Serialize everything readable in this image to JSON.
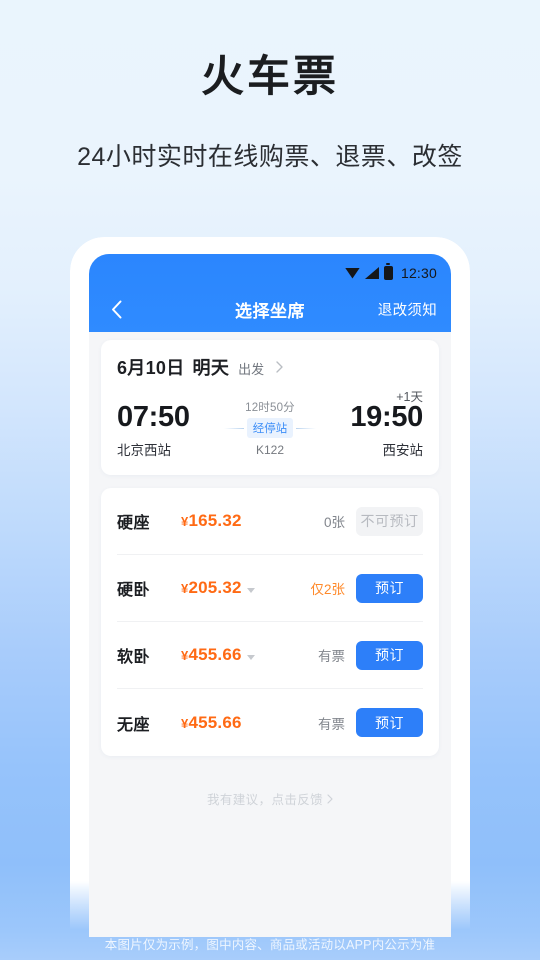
{
  "hero": {
    "title": "火车票",
    "subtitle": "24小时实时在线购票、退票、改签"
  },
  "phone": {
    "status_bar": {
      "time": "12:30",
      "icons": [
        "wifi-icon",
        "signal-icon",
        "battery-icon"
      ]
    },
    "navbar": {
      "back_icon": "chevron-left-icon",
      "title": "选择坐席",
      "right_link": "退改须知"
    },
    "trip_card": {
      "date": "6月10日",
      "day_label": "明天",
      "depart_label": "出发",
      "chevron_icon": "chevron-right-icon",
      "depart_time": "07:50",
      "depart_station": "北京西站",
      "arrive_time": "19:50",
      "arrive_station": "西安站",
      "plus_day": "+1天",
      "duration": "12时50分",
      "stop_badge": "经停站",
      "train_no": "K122"
    },
    "seat_table": {
      "rows": [
        {
          "name": "硬座",
          "currency": "¥",
          "price": "165.32",
          "has_caret": false,
          "stock": "0张",
          "stock_warn": false,
          "button": "不可预订",
          "enabled": false
        },
        {
          "name": "硬卧",
          "currency": "¥",
          "price": "205.32",
          "has_caret": true,
          "stock": "仅2张",
          "stock_warn": true,
          "button": "预订",
          "enabled": true
        },
        {
          "name": "软卧",
          "currency": "¥",
          "price": "455.66",
          "has_caret": true,
          "stock": "有票",
          "stock_warn": false,
          "button": "预订",
          "enabled": true
        },
        {
          "name": "无座",
          "currency": "¥",
          "price": "455.66",
          "has_caret": false,
          "stock": "有票",
          "stock_warn": false,
          "button": "预订",
          "enabled": true
        }
      ]
    },
    "feedback": {
      "text": "我有建议，点击反馈",
      "chevron_icon": "chevron-right-icon"
    }
  },
  "footer_note": "本图片仅为示例，图中内容、商品或活动以APP内公示为准",
  "colors": {
    "brand_blue": "#2d7ff9",
    "header_blue": "#2f8bff",
    "price_orange": "#ff6a14",
    "warn_orange": "#ff8a2b",
    "disabled_gray": "#f2f3f5"
  }
}
